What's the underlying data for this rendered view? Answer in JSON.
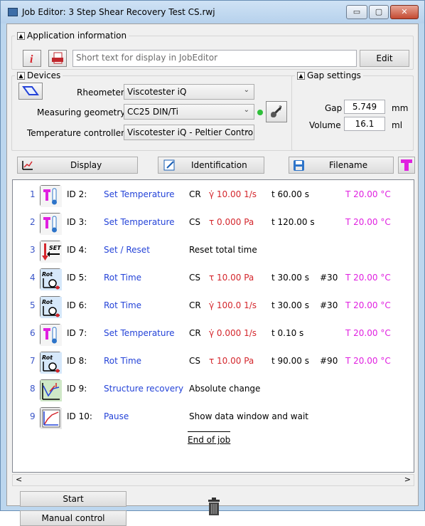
{
  "window": {
    "title": "Job Editor: 3 Step Shear Recovery Test CS.rwj",
    "min": "▭",
    "max": "▢",
    "close": "✕"
  },
  "app_info": {
    "header": "Application information",
    "placeholder": "Short text for display in JobEditor",
    "edit": "Edit"
  },
  "devices": {
    "header": "Devices",
    "rheometer_label": "Rheometer",
    "rheometer_value": "Viscotester iQ",
    "geometry_label": "Measuring geometry",
    "geometry_value": "CC25 DIN/Ti",
    "temp_label": "Temperature controller",
    "temp_value": "Viscotester iQ - Peltier Contro"
  },
  "gap": {
    "header": "Gap settings",
    "gap_label": "Gap",
    "gap_value": "5.749",
    "gap_unit": "mm",
    "volume_label": "Volume",
    "volume_value": "16.1",
    "volume_unit": "ml"
  },
  "toolbar": {
    "display": "Display",
    "identification": "Identification",
    "filename": "Filename"
  },
  "steps": [
    {
      "num": "1",
      "id": "ID 2:",
      "name": "Set Temperature",
      "mode": "CR",
      "param": "γ̇ 10.00 1/s",
      "time": "t 60.00 s",
      "pts": "",
      "temp": "T 20.00 °C",
      "icon": "temperature-icon"
    },
    {
      "num": "2",
      "id": "ID 3:",
      "name": "Set Temperature",
      "mode": "CS",
      "param": "τ 0.000 Pa",
      "time": "t 120.00 s",
      "pts": "",
      "temp": "T 20.00 °C",
      "icon": "temperature-icon"
    },
    {
      "num": "3",
      "id": "ID 4:",
      "name": "Set / Reset",
      "mode": "Reset total time",
      "param": "",
      "time": "",
      "pts": "",
      "temp": "",
      "icon": "set-reset-icon"
    },
    {
      "num": "4",
      "id": "ID 5:",
      "name": "Rot Time",
      "mode": "CS",
      "param": "τ 10.00 Pa",
      "time": "t 30.00 s",
      "pts": "#30",
      "temp": "T 20.00 °C",
      "icon": "rot-time-icon"
    },
    {
      "num": "5",
      "id": "ID 6:",
      "name": "Rot Time",
      "mode": "CR",
      "param": "γ̇ 100.0 1/s",
      "time": "t 30.00 s",
      "pts": "#30",
      "temp": "T 20.00 °C",
      "icon": "rot-time-icon"
    },
    {
      "num": "6",
      "id": "ID 7:",
      "name": "Set Temperature",
      "mode": "CR",
      "param": "γ̇ 0.000 1/s",
      "time": "t 0.10 s",
      "pts": "",
      "temp": "T 20.00 °C",
      "icon": "temperature-icon"
    },
    {
      "num": "7",
      "id": "ID 8:",
      "name": "Rot Time",
      "mode": "CS",
      "param": "τ 10.00 Pa",
      "time": "t 90.00 s",
      "pts": "#90",
      "temp": "T 20.00 °C",
      "icon": "rot-time-icon"
    },
    {
      "num": "8",
      "id": "ID 9:",
      "name": "Structure recovery",
      "mode": "Absolute change",
      "param": "",
      "time": "",
      "pts": "",
      "temp": "",
      "icon": "structure-recovery-icon"
    },
    {
      "num": "9",
      "id": "ID 10:",
      "name": "Pause",
      "mode": "Show data window and wait",
      "param": "",
      "time": "",
      "pts": "",
      "temp": "",
      "icon": "pause-icon"
    }
  ],
  "end_of_job": "End of job",
  "footer": {
    "start": "Start",
    "manual": "Manual control"
  },
  "colors": {
    "step_name": "#2443d8",
    "param": "#d4262c",
    "temperature": "#e020e0"
  }
}
